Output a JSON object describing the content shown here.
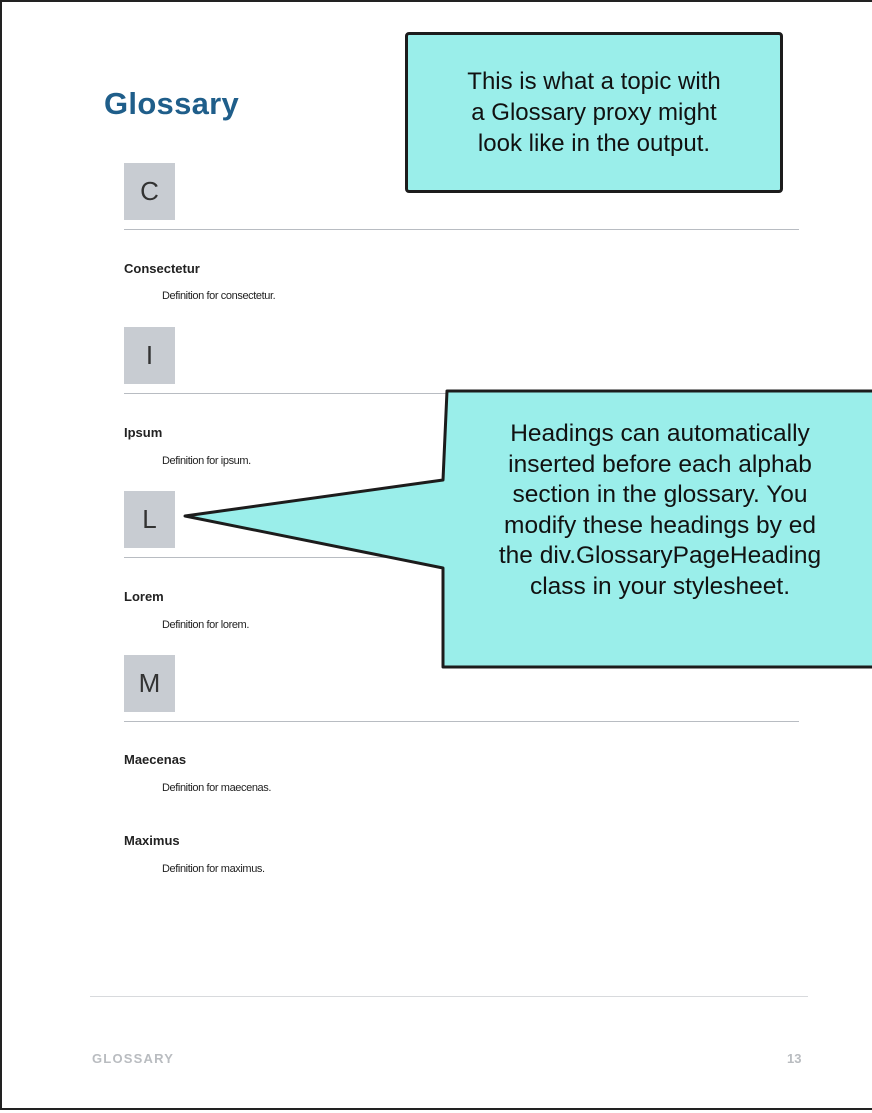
{
  "page": {
    "title": "Glossary",
    "footer_label": "GLOSSARY",
    "page_number": "13"
  },
  "sections": [
    {
      "letter": "C",
      "entries": [
        {
          "term": "Consectetur",
          "definition": "Definition for consectetur."
        }
      ]
    },
    {
      "letter": "I",
      "entries": [
        {
          "term": "Ipsum",
          "definition": "Definition for ipsum."
        }
      ]
    },
    {
      "letter": "L",
      "entries": [
        {
          "term": "Lorem",
          "definition": "Definition for lorem."
        }
      ]
    },
    {
      "letter": "M",
      "entries": [
        {
          "term": "Maecenas",
          "definition": "Definition for maecenas."
        },
        {
          "term": "Maximus",
          "definition": "Definition for maximus."
        }
      ]
    }
  ],
  "callouts": {
    "topic_note": [
      "This is what a topic with",
      "a Glossary proxy might",
      "look like in the output."
    ],
    "heading_note": [
      "Headings can automatically",
      "inserted before each alphab",
      "section in the glossary. You",
      "modify these headings by ed",
      "the div.GlossaryPageHeading",
      "class in your stylesheet."
    ]
  },
  "colors": {
    "title": "#1f5e8a",
    "callout_fill": "#9aeeea",
    "letter_box": "#c8ccd2",
    "footer_text": "#b9bcc0"
  }
}
